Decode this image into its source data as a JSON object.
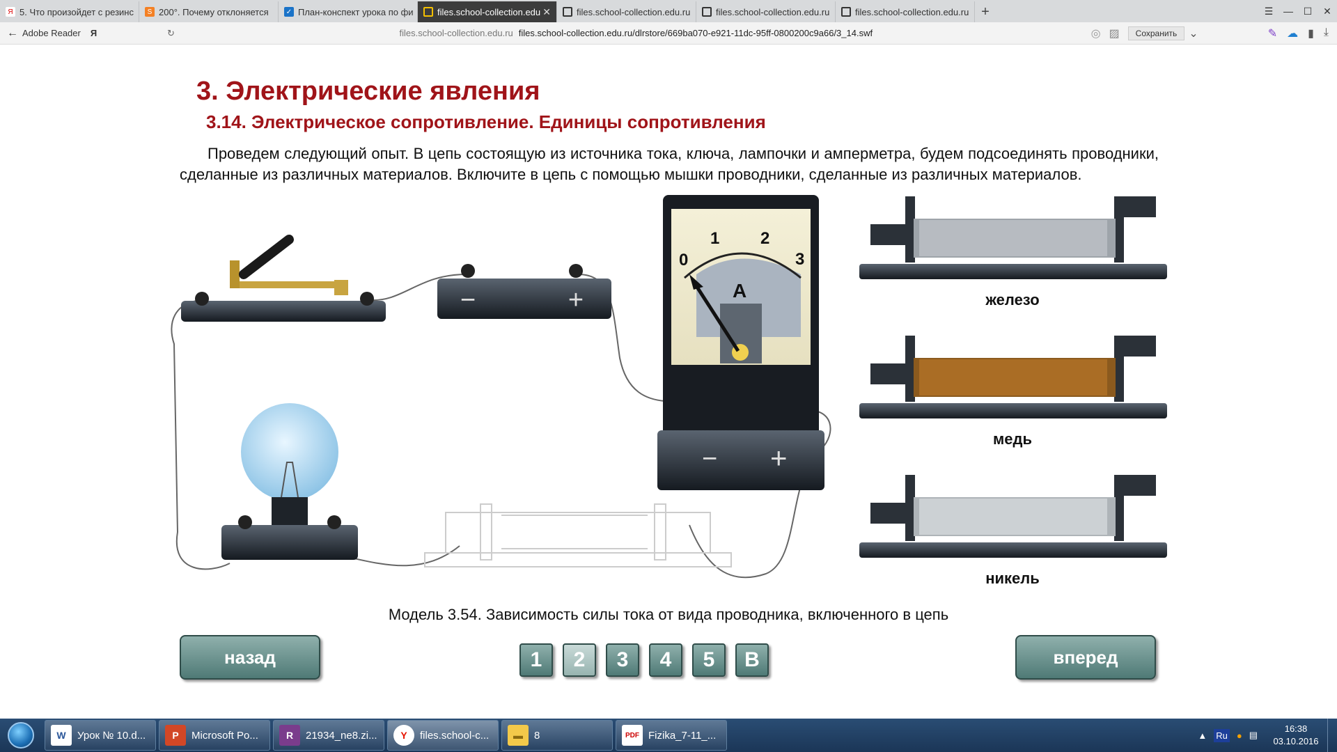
{
  "browser": {
    "tabs": [
      {
        "label": "5. Что произойдет с резинс",
        "icon": "yandex-icon"
      },
      {
        "label": "200°. Почему отклоняется",
        "icon": "stack-icon"
      },
      {
        "label": "План-конспект урока по фи",
        "icon": "checkbox-icon"
      },
      {
        "label": "files.school-collection.edu",
        "icon": "page-icon",
        "active": true
      },
      {
        "label": "files.school-collection.edu.ru",
        "icon": "page-icon"
      },
      {
        "label": "files.school-collection.edu.ru",
        "icon": "page-icon"
      },
      {
        "label": "files.school-collection.edu.ru",
        "icon": "page-icon"
      }
    ],
    "back_label": "Adobe Reader",
    "yandex_letter": "Я",
    "url_host": "files.school-collection.edu.ru",
    "url_full": "files.school-collection.edu.ru/dlrstore/669ba070-e921-11dc-95ff-0800200c9a66/3_14.swf",
    "save_label": "Сохранить"
  },
  "lesson": {
    "title": "3. Электрические явления",
    "subtitle": "3.14. Электрическое сопротивление. Единицы сопротивления",
    "text": "Проведем следующий опыт. В цепь состоящую из источника тока, ключа, лампочки и амперметра, будем подсоединять проводники, сделанные из различных материалов. Включите в цепь с помощью мышки проводники, сделанные из различных материалов.",
    "materials": [
      "железо",
      "медь",
      "никель"
    ],
    "ammeter": {
      "ticks": [
        "0",
        "1",
        "2",
        "3"
      ],
      "unit": "A"
    },
    "battery": {
      "minus": "−",
      "plus": "+"
    },
    "caption": "Модель 3.54. Зависимость силы тока от вида проводника, включенного в цепь",
    "back_button": "назад",
    "forward_button": "вперед",
    "pages": [
      "1",
      "2",
      "3",
      "4",
      "5",
      "В"
    ],
    "current_page": "2"
  },
  "taskbar": {
    "items": [
      {
        "label": "Урок № 10.d...",
        "icon": "word-icon"
      },
      {
        "label": "Microsoft Po...",
        "icon": "powerpoint-icon"
      },
      {
        "label": "21934_ne8.zi...",
        "icon": "winrar-icon"
      },
      {
        "label": "files.school-c...",
        "icon": "yandex-browser-icon"
      },
      {
        "label": "8",
        "icon": "folder-icon"
      },
      {
        "label": "Fizika_7-11_...",
        "icon": "pdf-icon"
      }
    ],
    "lang": "Ru",
    "time": "16:38",
    "date": "03.10.2016"
  }
}
